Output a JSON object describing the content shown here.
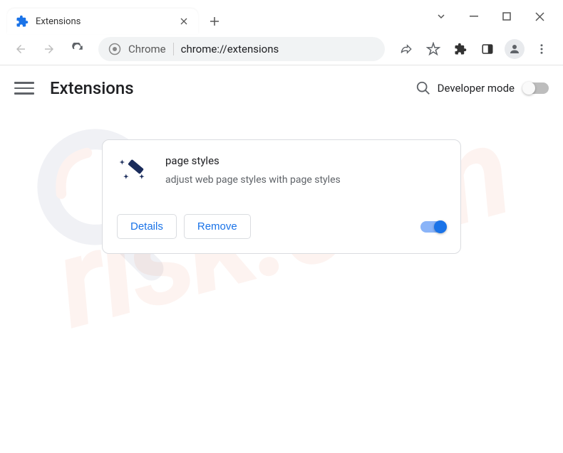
{
  "window": {
    "tab_title": "Extensions"
  },
  "omnibox": {
    "label": "Chrome",
    "url": "chrome://extensions"
  },
  "header": {
    "title": "Extensions",
    "dev_mode_label": "Developer mode",
    "dev_mode_enabled": false
  },
  "extension": {
    "name": "page styles",
    "description": "adjust web page styles with page styles",
    "details_label": "Details",
    "remove_label": "Remove",
    "enabled": true,
    "icon_name": "magic-wand-icon"
  },
  "watermark": {
    "text": "risk.com"
  }
}
